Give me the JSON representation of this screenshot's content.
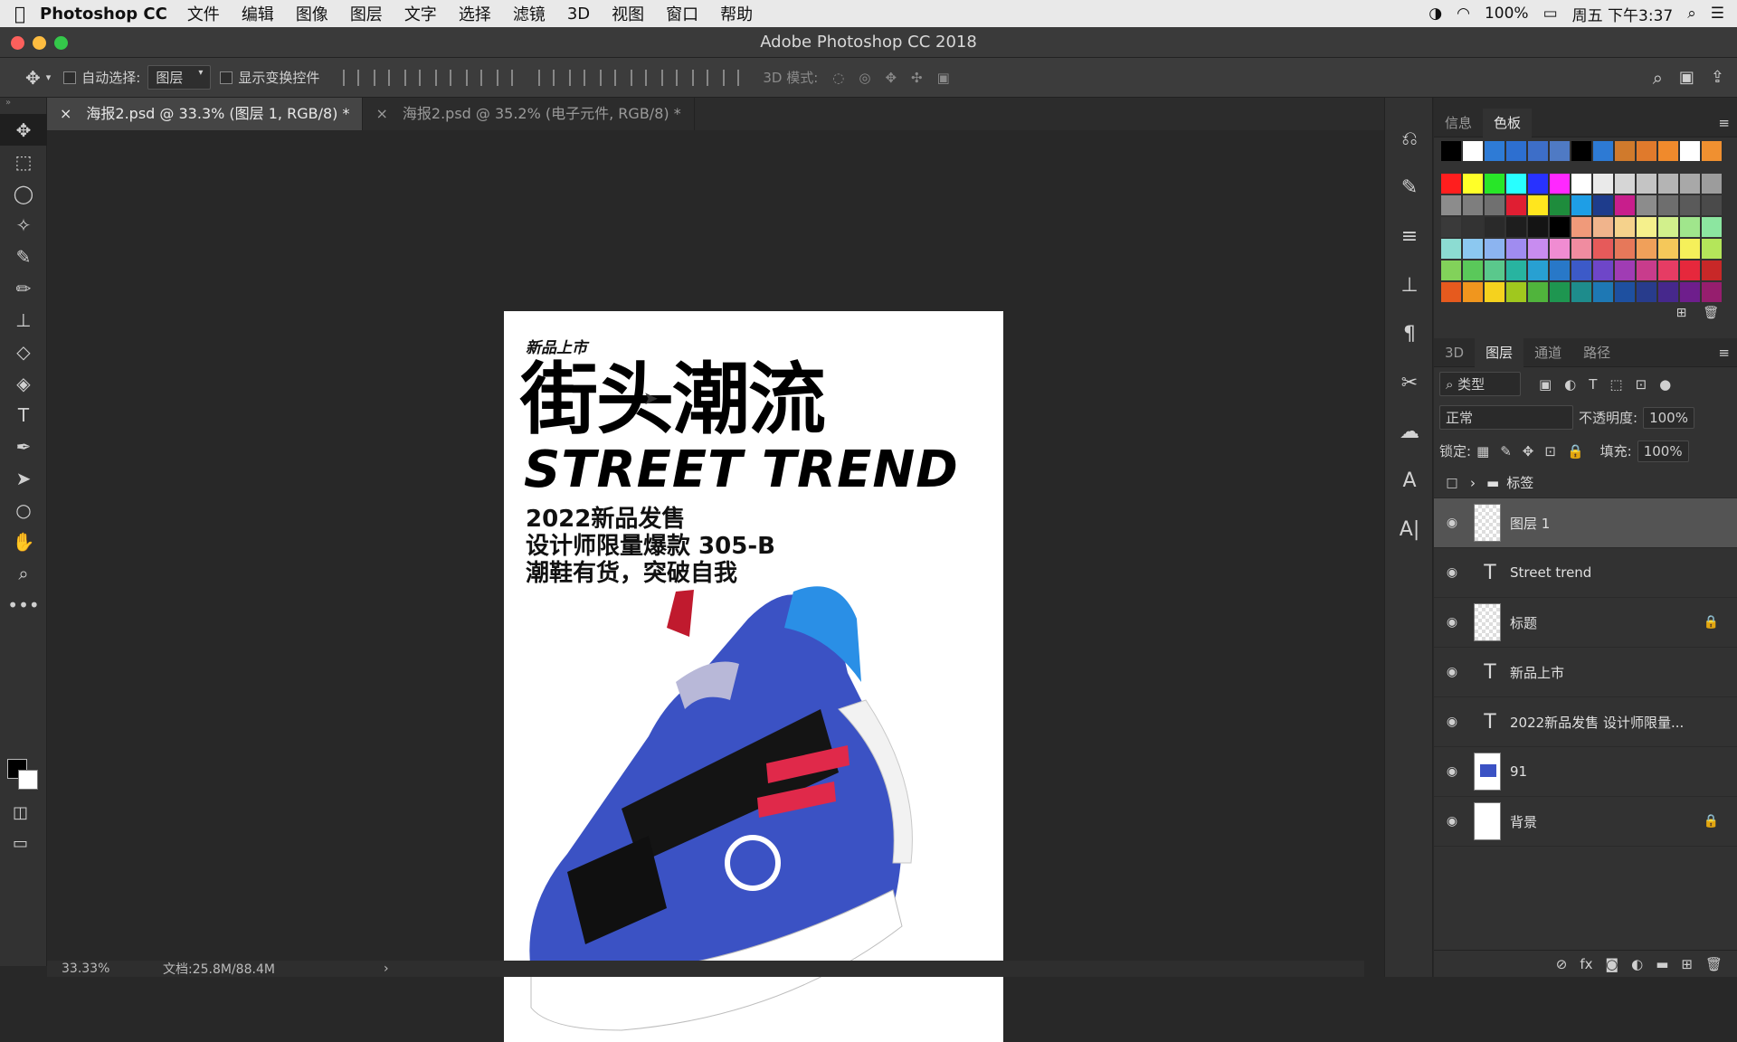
{
  "menubar": {
    "app_name": "Photoshop CC",
    "items": [
      "文件",
      "编辑",
      "图像",
      "图层",
      "文字",
      "选择",
      "滤镜",
      "3D",
      "视图",
      "窗口",
      "帮助"
    ],
    "battery": "100%",
    "clock": "周五 下午3:37"
  },
  "window": {
    "title": "Adobe Photoshop CC 2018"
  },
  "options": {
    "auto_select_label": "自动选择:",
    "auto_select_value": "图层",
    "show_transform_label": "显示变换控件",
    "mode_3d_label": "3D 模式:"
  },
  "tabs": [
    {
      "label": "海报2.psd @ 33.3% (图层 1, RGB/8) *"
    },
    {
      "label": "海报2.psd @ 35.2% (电子元件, RGB/8) *"
    }
  ],
  "poster": {
    "kicker": "新品上市",
    "headline": "街头潮流",
    "english": "STREET TREND",
    "line1": "2022新品发售",
    "line2": "设计师限量爆款 305-B",
    "line3": "潮鞋有货，突破自我"
  },
  "status": {
    "zoom": "33.33%",
    "doc": "文档:25.8M/88.4M"
  },
  "swatch_panel": {
    "tabs": [
      "信息",
      "色板"
    ],
    "row0": [
      "#000000",
      "#ffffff",
      "#2e7bd6",
      "#2d6fd0",
      "#3d6ec8",
      "#4f7ac4",
      "#000000",
      "#2d7ad4",
      "#d07a2c",
      "#e07a2c",
      "#f08a2c",
      "#ffffff",
      "#f09030"
    ],
    "rows": [
      [
        "#ff1e1e",
        "#ffff28",
        "#28e628",
        "#28ffff",
        "#2832ff",
        "#ff28ff",
        "#ffffff",
        "#eaeaea",
        "#d6d6d6",
        "#c4c4c4",
        "#b4b4b4",
        "#a8a8a8",
        "#9c9c9c"
      ],
      [
        "#8c8c8c",
        "#7e7e7e",
        "#707070",
        "#e01e32",
        "#ffe61e",
        "#1e8c3c",
        "#1e9ee6",
        "#1e3c8c",
        "#c81e8c",
        "#8c8c8c",
        "#6e6e6e",
        "#5a5a5a",
        "#4a4a4a"
      ],
      [
        "#3a3a3a",
        "#333333",
        "#2a2a2a",
        "#1e1e1e",
        "#141414",
        "#000000",
        "#f09a7a",
        "#f0b48c",
        "#f5d28c",
        "#f5f08c",
        "#d2f08c",
        "#a0e68c",
        "#8ce6a0"
      ],
      [
        "#8cdcd2",
        "#8cc8f0",
        "#8cb4f0",
        "#a08cf0",
        "#c88cf0",
        "#f08cd2",
        "#f08ca0",
        "#e65a5a",
        "#e6785a",
        "#f0a05a",
        "#f5c85a",
        "#f5f05a",
        "#b4e65a"
      ],
      [
        "#82d25a",
        "#5ac85a",
        "#5ac88c",
        "#28b4a0",
        "#28a0d2",
        "#2878c8",
        "#3c5ac8",
        "#6e46c8",
        "#a03cb4",
        "#c83c8c",
        "#e63c64",
        "#e6283c",
        "#c82828"
      ],
      [
        "#e65a1e",
        "#f0961e",
        "#f5d21e",
        "#a0c81e",
        "#50b43c",
        "#1e9650",
        "#1e8c8c",
        "#1e78b4",
        "#1e50a0",
        "#283c8c",
        "#46288c",
        "#6e1e8c",
        "#961e6e"
      ]
    ]
  },
  "layers_panel": {
    "tabs": [
      "3D",
      "图层",
      "通道",
      "路径"
    ],
    "filter_label": "类型",
    "blend_mode": "正常",
    "opacity_label": "不透明度:",
    "opacity_value": "100%",
    "lock_label": "锁定:",
    "fill_label": "填充:",
    "fill_value": "100%",
    "layers": [
      {
        "name": "标签",
        "kind": "group",
        "visible": false,
        "locked": false
      },
      {
        "name": "图层 1",
        "kind": "pixel",
        "visible": true,
        "locked": false,
        "selected": true
      },
      {
        "name": "Street trend",
        "kind": "text",
        "visible": true,
        "locked": false
      },
      {
        "name": "标题",
        "kind": "pixel",
        "visible": true,
        "locked": true
      },
      {
        "name": "新品上市",
        "kind": "text",
        "visible": true,
        "locked": false
      },
      {
        "name": "2022新品发售 设计师限量...",
        "kind": "text",
        "visible": true,
        "locked": false
      },
      {
        "name": "91",
        "kind": "image",
        "visible": true,
        "locked": false
      },
      {
        "name": "背景",
        "kind": "fill",
        "visible": true,
        "locked": true
      }
    ]
  }
}
